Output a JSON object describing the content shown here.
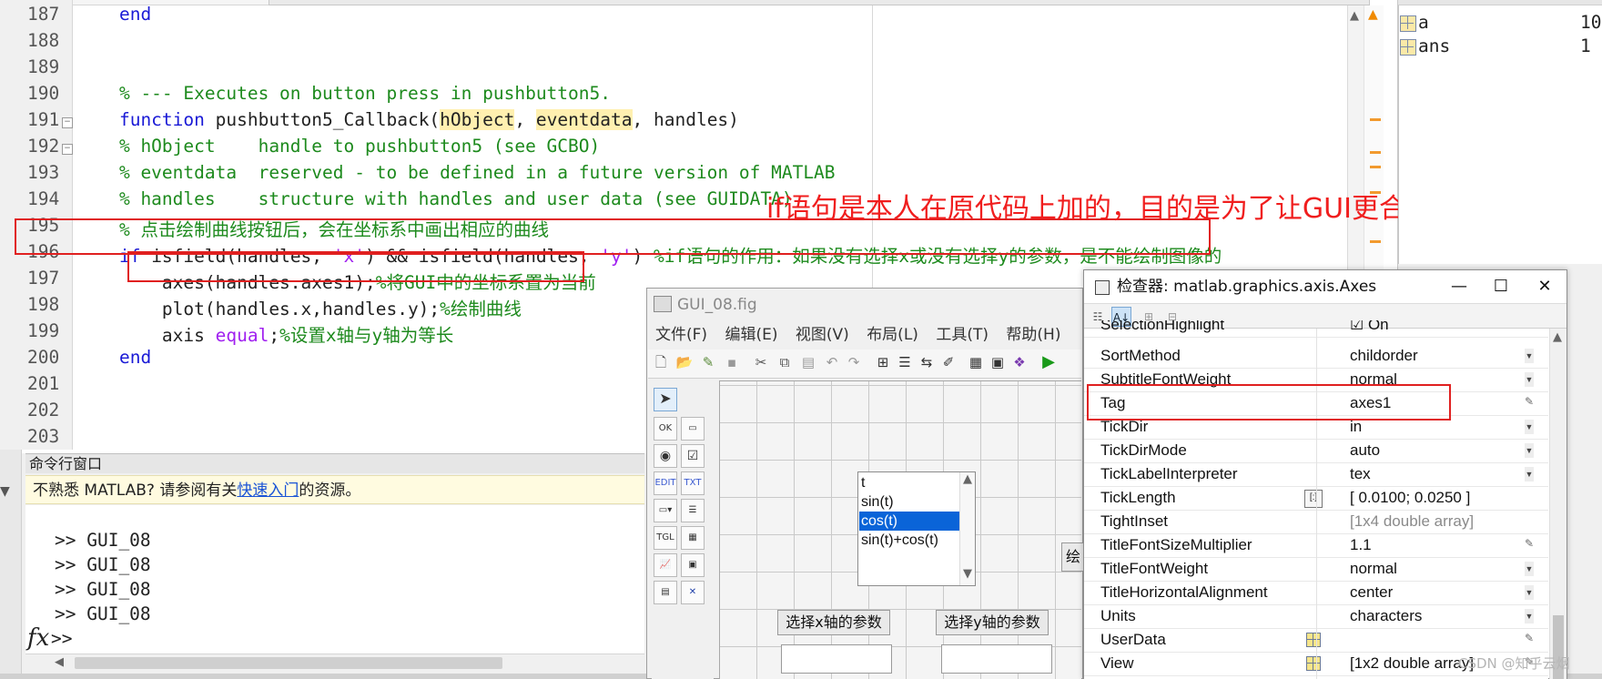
{
  "editor": {
    "lines": [
      {
        "no": "187",
        "segs": [
          {
            "t": "    end",
            "c": "kw"
          }
        ]
      },
      {
        "no": "188",
        "segs": []
      },
      {
        "no": "189",
        "segs": []
      },
      {
        "no": "190",
        "segs": [
          {
            "t": "    % --- Executes on button press in pushbutton5.",
            "c": "cm"
          }
        ]
      },
      {
        "no": "191",
        "fold": "−",
        "segs": [
          {
            "t": "    function",
            "c": "kw"
          },
          {
            "t": " pushbutton5_Callback(",
            "c": ""
          },
          {
            "t": "hObject",
            "c": "hl"
          },
          {
            "t": ", ",
            "c": ""
          },
          {
            "t": "eventdata",
            "c": "hl"
          },
          {
            "t": ", handles)",
            "c": ""
          }
        ]
      },
      {
        "no": "192",
        "fold": "−",
        "segs": [
          {
            "t": "    % hObject    handle to pushbutton5 (see GCBO)",
            "c": "cm"
          }
        ]
      },
      {
        "no": "193",
        "segs": [
          {
            "t": "    % eventdata  reserved - to be defined in a future version of MATLAB",
            "c": "cm"
          }
        ]
      },
      {
        "no": "194",
        "segs": [
          {
            "t": "    % handles    structure with handles and user data (see GUIDATA)",
            "c": "cm"
          }
        ]
      },
      {
        "no": "195",
        "segs": [
          {
            "t": "    % 点击绘制曲线按钮后，会在坐标系中画出相应的曲线",
            "c": "cm"
          }
        ]
      },
      {
        "no": "196",
        "segs": [
          {
            "t": "    if",
            "c": "kw"
          },
          {
            "t": " isfield(handles, ",
            "c": ""
          },
          {
            "t": "'x'",
            "c": "st"
          },
          {
            "t": ") && isfield(handles, ",
            "c": ""
          },
          {
            "t": "'y'",
            "c": "st"
          },
          {
            "t": ") ",
            "c": ""
          },
          {
            "t": "%if语句的作用：如果没有选择x或没有选择y的参数，是不能绘制图像的",
            "c": "cm"
          }
        ]
      },
      {
        "no": "197",
        "segs": [
          {
            "t": "        axes(handles.axes1);",
            "c": ""
          },
          {
            "t": "%将GUI中的坐标系置为当前",
            "c": "cm"
          }
        ]
      },
      {
        "no": "198",
        "segs": [
          {
            "t": "        plot(handles.x,handles.y);",
            "c": ""
          },
          {
            "t": "%绘制曲线",
            "c": "cm"
          }
        ]
      },
      {
        "no": "199",
        "segs": [
          {
            "t": "        axis ",
            "c": ""
          },
          {
            "t": "equal",
            "c": "st"
          },
          {
            "t": ";",
            "c": ""
          },
          {
            "t": "%设置x轴与y轴为等长",
            "c": "cm"
          }
        ]
      },
      {
        "no": "200",
        "segs": [
          {
            "t": "    end",
            "c": "kw"
          }
        ]
      },
      {
        "no": "201",
        "segs": []
      },
      {
        "no": "202",
        "segs": []
      },
      {
        "no": "203",
        "segs": []
      }
    ],
    "warning_glyph": "▲",
    "annotation": "if语句是本人在原代码上加的，目的是为了让GUI更合理"
  },
  "workspace": {
    "rows": [
      {
        "name": "a",
        "value": "10"
      },
      {
        "name": "ans",
        "value": "1"
      }
    ]
  },
  "command_window": {
    "title": "命令行窗口",
    "notice_prefix": "不熟悉 MATLAB? 请参阅有关",
    "notice_link": "快速入门",
    "notice_suffix": "的资源。",
    "history": [
      ">> GUI_08",
      ">> GUI_08",
      ">> GUI_08",
      ">> GUI_08"
    ],
    "prompt": ">>",
    "fx": "fx"
  },
  "guide": {
    "title": "GUI_08.fig",
    "menus": [
      "文件(F)",
      "编辑(E)",
      "视图(V)",
      "布局(L)",
      "工具(T)",
      "帮助(H)"
    ],
    "listbox_items": [
      "t",
      "sin(t)",
      "cos(t)",
      "sin(t)+cos(t)"
    ],
    "listbox_selected": 2,
    "btn_x": "选择x轴的参数",
    "btn_y": "选择y轴的参数",
    "partial_btn": "绘"
  },
  "inspector": {
    "title": "检查器: matlab.graphics.axis.Axes",
    "win_min": "—",
    "win_max": "☐",
    "win_close": "✕",
    "props": [
      {
        "name": "SelectionHighlight",
        "value": "☑ On",
        "kind": "partial"
      },
      {
        "name": "SortMethod",
        "value": "childorder",
        "kind": "dd"
      },
      {
        "name": "SubtitleFontWeight",
        "value": "normal",
        "kind": "dd"
      },
      {
        "name": "Tag",
        "value": "axes1",
        "kind": "ed"
      },
      {
        "name": "TickDir",
        "value": "in",
        "kind": "dd"
      },
      {
        "name": "TickDirMode",
        "value": "auto",
        "kind": "dd"
      },
      {
        "name": "TickLabelInterpreter",
        "value": "tex",
        "kind": "dd"
      },
      {
        "name": "TickLength",
        "value": "[ 0.0100; 0.0250 ]",
        "kind": "sq"
      },
      {
        "name": "TightInset",
        "value": "[1x4  double array]",
        "kind": "gray"
      },
      {
        "name": "TitleFontSizeMultiplier",
        "value": "1.1",
        "kind": "ed"
      },
      {
        "name": "TitleFontWeight",
        "value": "normal",
        "kind": "dd"
      },
      {
        "name": "TitleHorizontalAlignment",
        "value": "center",
        "kind": "dd"
      },
      {
        "name": "Units",
        "value": "characters",
        "kind": "dd"
      },
      {
        "name": "UserData",
        "value": "",
        "kind": "grid_ed"
      },
      {
        "name": "View",
        "value": "[1x2  double array]",
        "kind": "grid_ed"
      }
    ]
  },
  "watermark": "CSDN @知乎云烟",
  "colors": {
    "annotation_red": "#e02020",
    "keyword_blue": "#1a1ad6",
    "comment_green": "#1d8a1d",
    "string_purple": "#a020f0"
  }
}
